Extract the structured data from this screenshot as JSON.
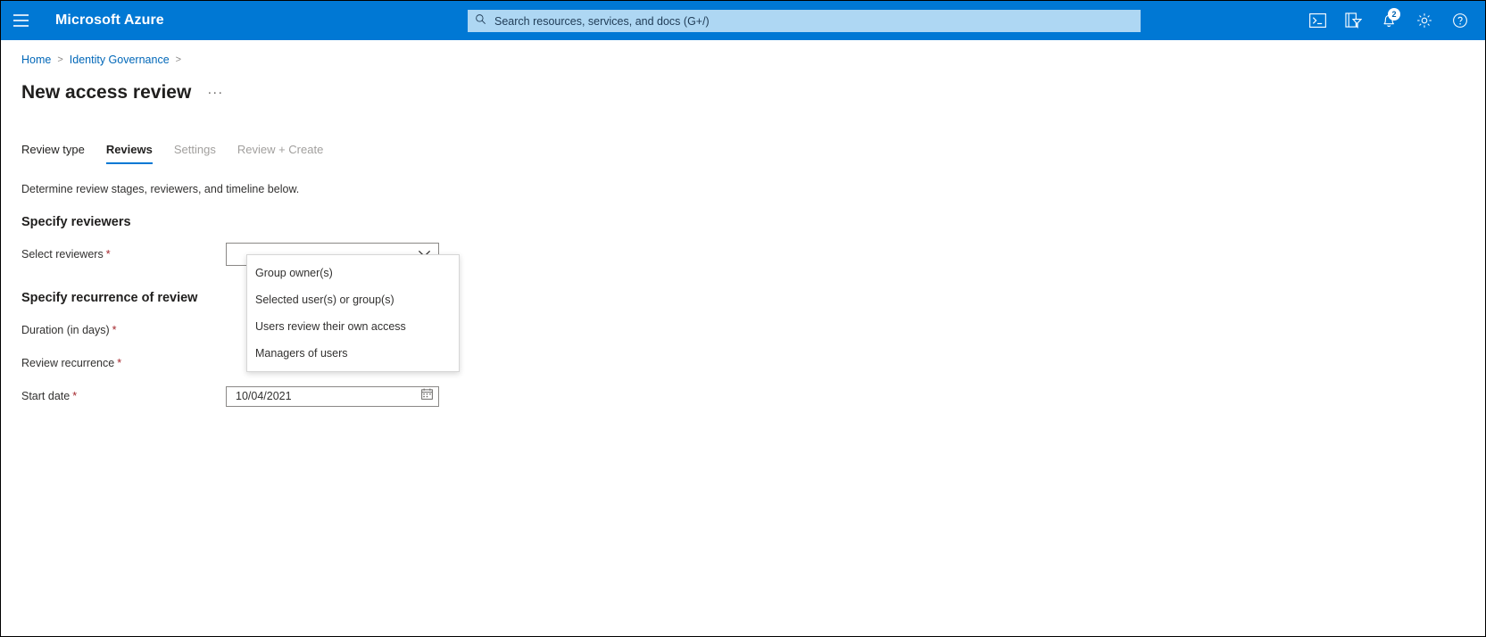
{
  "topbar": {
    "menu_icon": "hamburger-icon",
    "brand": "Microsoft Azure",
    "search": {
      "icon": "search-icon",
      "placeholder": "Search resources, services, and docs (G+/)",
      "value": ""
    },
    "icons": [
      {
        "name": "cloud-shell-icon",
        "label": "Cloud Shell"
      },
      {
        "name": "directories-filter-icon",
        "label": "Directories + subscriptions"
      },
      {
        "name": "notifications-bell-icon",
        "label": "Notifications",
        "badge": "2"
      },
      {
        "name": "settings-gear-icon",
        "label": "Settings"
      },
      {
        "name": "help-question-icon",
        "label": "Help"
      }
    ],
    "accent_color": "#0078d4",
    "search_bg_color": "#aed7f3"
  },
  "breadcrumb": {
    "items": [
      {
        "label": "Home",
        "link": true
      },
      {
        "label": "Identity Governance",
        "link": true
      }
    ],
    "separator": ">"
  },
  "page": {
    "title": "New access review",
    "more_actions": "···"
  },
  "tabs": [
    {
      "label": "Review type",
      "state": "enabled"
    },
    {
      "label": "Reviews",
      "state": "active"
    },
    {
      "label": "Settings",
      "state": "disabled"
    },
    {
      "label": "Review + Create",
      "state": "disabled"
    }
  ],
  "main": {
    "description": "Determine review stages, reviewers, and timeline below.",
    "sections": [
      {
        "heading": "Specify reviewers",
        "fields": [
          {
            "label": "Select reviewers",
            "required": true,
            "type": "select",
            "value": ""
          }
        ]
      },
      {
        "heading": "Specify recurrence of review",
        "fields": [
          {
            "label": "Duration (in days)",
            "required": true,
            "type": "text",
            "value": ""
          },
          {
            "label": "Review recurrence",
            "required": true,
            "type": "select",
            "value": ""
          },
          {
            "label": "Start date",
            "required": true,
            "type": "date",
            "value": "10/04/2021",
            "icon": "calendar-icon"
          }
        ]
      }
    ]
  },
  "dropdown": {
    "open": true,
    "owner_field": "Select reviewers",
    "options": [
      "Group owner(s)",
      "Selected user(s) or group(s)",
      "Users review their own access",
      "Managers of users"
    ]
  },
  "colors": {
    "azure_blue": "#0078d4",
    "link_blue": "#0067b8",
    "required_red": "#a4262c",
    "disabled_grey": "#a19f9d",
    "border_grey": "#8a8886"
  }
}
